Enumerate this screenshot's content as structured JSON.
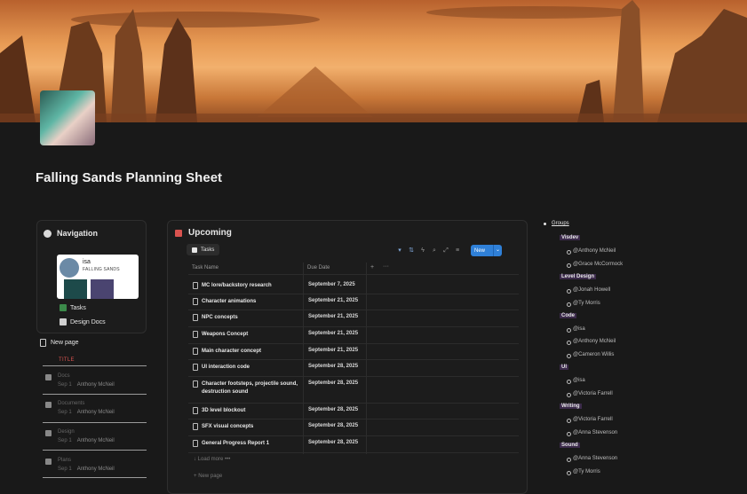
{
  "page": {
    "title": "Falling Sands Planning Sheet"
  },
  "navigation": {
    "heading": "Navigation",
    "profile_name": "isa",
    "profile_sub": "FALLING SANDS",
    "links": [
      "Tasks",
      "Design Docs"
    ]
  },
  "sidebar_list": {
    "new_page": "New page",
    "column_title": "TITLE",
    "items": [
      {
        "title": "Docs",
        "meta_label": "Sep 1",
        "meta_user": "Anthony McNeil"
      },
      {
        "title": "Documents",
        "meta_label": "Sep 1",
        "meta_user": "Anthony McNeil"
      },
      {
        "title": "Design",
        "meta_label": "Sep 1",
        "meta_user": "Anthony McNeil"
      },
      {
        "title": "Plans",
        "meta_label": "Sep 1",
        "meta_user": "Anthony McNeil"
      }
    ]
  },
  "upcoming": {
    "title": "Upcoming",
    "tab": "Tasks",
    "new_button": "New",
    "columns": [
      "Task Name",
      "Due Date"
    ],
    "rows": [
      {
        "name": "MC lore/backstory research",
        "date": "September 7, 2025"
      },
      {
        "name": "Character animations",
        "date": "September 21, 2025"
      },
      {
        "name": "NPC concepts",
        "date": "September 21, 2025"
      },
      {
        "name": "Weapons Concept",
        "date": "September 21, 2025"
      },
      {
        "name": "Main character concept",
        "date": "September 21, 2025"
      },
      {
        "name": "UI interaction code",
        "date": "September 28, 2025"
      },
      {
        "name": "Character footsteps, projectile sound, destruction sound",
        "date": "September 28, 2025"
      },
      {
        "name": "3D level blockout",
        "date": "September 28, 2025"
      },
      {
        "name": "SFX visual concepts",
        "date": "September 28, 2025"
      },
      {
        "name": "General Progress Report 1",
        "date": "September 28, 2025"
      }
    ],
    "load_more": "Load more",
    "new_page": "New page"
  },
  "groups": {
    "title": "Groups",
    "categories": [
      {
        "name": "Visdev",
        "members": [
          "@Anthony McNeil",
          "@Grace McCormock"
        ]
      },
      {
        "name": "Level Design",
        "members": [
          "@Jonah Howell",
          "@Ty Morris"
        ]
      },
      {
        "name": "Code",
        "members": [
          "@isa",
          "@Anthony McNeil",
          "@Cameron Willis"
        ]
      },
      {
        "name": "UI",
        "members": [
          "@isa",
          "@Victoria Farrell"
        ]
      },
      {
        "name": "Writing",
        "members": [
          "@Victoria Farrell",
          "@Anna Stevenson"
        ]
      },
      {
        "name": "Sound",
        "members": [
          "@Anna Stevenson",
          "@Ty Morris"
        ]
      }
    ]
  },
  "colors": {
    "background": "#191919",
    "accent_blue": "#2f80d8",
    "title_red": "#d9534f",
    "group_tag": "#3b2a4a"
  }
}
